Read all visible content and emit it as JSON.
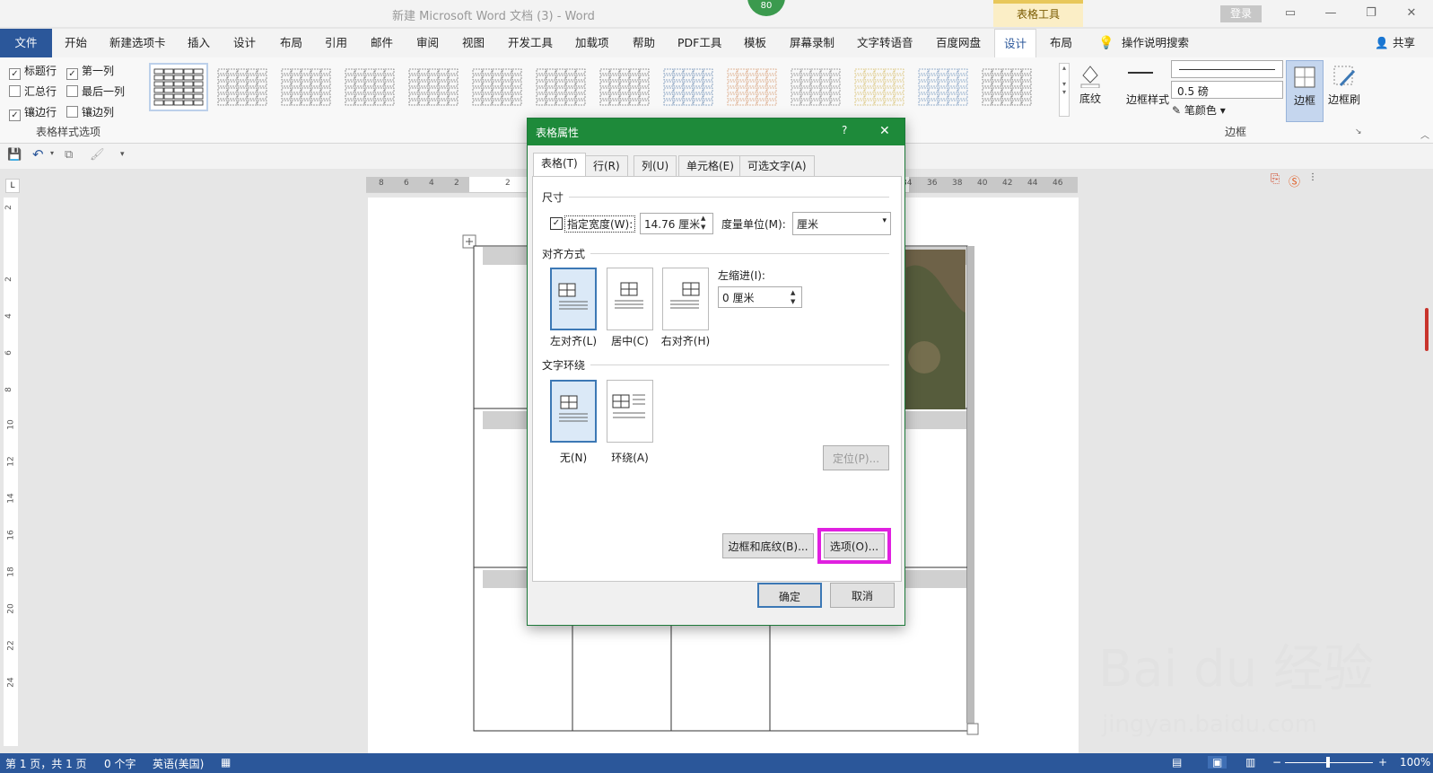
{
  "window": {
    "title": "新建 Microsoft Word 文档 (3)  -  Word",
    "context_group": "表格工具",
    "badge": "80",
    "login": "登录"
  },
  "menu": {
    "file": "文件",
    "items": [
      "开始",
      "新建选项卡",
      "插入",
      "设计",
      "布局",
      "引用",
      "邮件",
      "审阅",
      "视图",
      "开发工具",
      "加载项",
      "帮助",
      "PDF工具",
      "模板",
      "屏幕录制",
      "文字转语音",
      "百度网盘"
    ],
    "ctx_design": "设计",
    "ctx_layout": "布局",
    "tell_me": "操作说明搜索",
    "share": "共享"
  },
  "ribbon": {
    "options": [
      {
        "label": "标题行",
        "checked": true
      },
      {
        "label": "第一列",
        "checked": true
      },
      {
        "label": "汇总行",
        "checked": false
      },
      {
        "label": "最后一列",
        "checked": false
      },
      {
        "label": "镶边行",
        "checked": true
      },
      {
        "label": "镶边列",
        "checked": false
      }
    ],
    "options_group": "表格样式选项",
    "shading": "底纹",
    "border_style": "边框样式",
    "pen_weight": "0.5 磅",
    "pen_color": "笔颜色",
    "borders": "边框",
    "border_painter": "边框刷",
    "borders_group": "边框"
  },
  "ruler": {
    "h_left": [
      "8",
      "6",
      "4",
      "2"
    ],
    "h_right": [
      "34",
      "36",
      "38",
      "40",
      "42",
      "44",
      "46"
    ],
    "h_mid": "2",
    "v": [
      "2",
      "2",
      "4",
      "6",
      "8",
      "10",
      "12",
      "14",
      "16",
      "18",
      "20",
      "22",
      "24"
    ]
  },
  "dialog": {
    "title": "表格属性",
    "help": "?",
    "close": "✕",
    "tabs": [
      "表格(T)",
      "行(R)",
      "列(U)",
      "单元格(E)",
      "可选文字(A)"
    ],
    "size_section": "尺寸",
    "width_label": "指定宽度(W):",
    "width_value": "14.76 厘米",
    "unit_label": "度量单位(M):",
    "unit_value": "厘米",
    "align_section": "对齐方式",
    "align_left": "左对齐(L)",
    "align_center": "居中(C)",
    "align_right": "右对齐(H)",
    "indent_label": "左缩进(I):",
    "indent_value": "0 厘米",
    "wrap_section": "文字环绕",
    "wrap_none": "无(N)",
    "wrap_around": "环绕(A)",
    "positioning": "定位(P)...",
    "borders_shading": "边框和底纹(B)...",
    "options": "选项(O)...",
    "ok": "确定",
    "cancel": "取消"
  },
  "status": {
    "page": "第 1 页，共 1 页",
    "words": "0 个字",
    "language": "英语(美国)",
    "zoom": "100%"
  },
  "colors": {
    "accent": "#2b579a",
    "dialog_title": "#1e8a3a",
    "highlight": "#e020e0"
  }
}
